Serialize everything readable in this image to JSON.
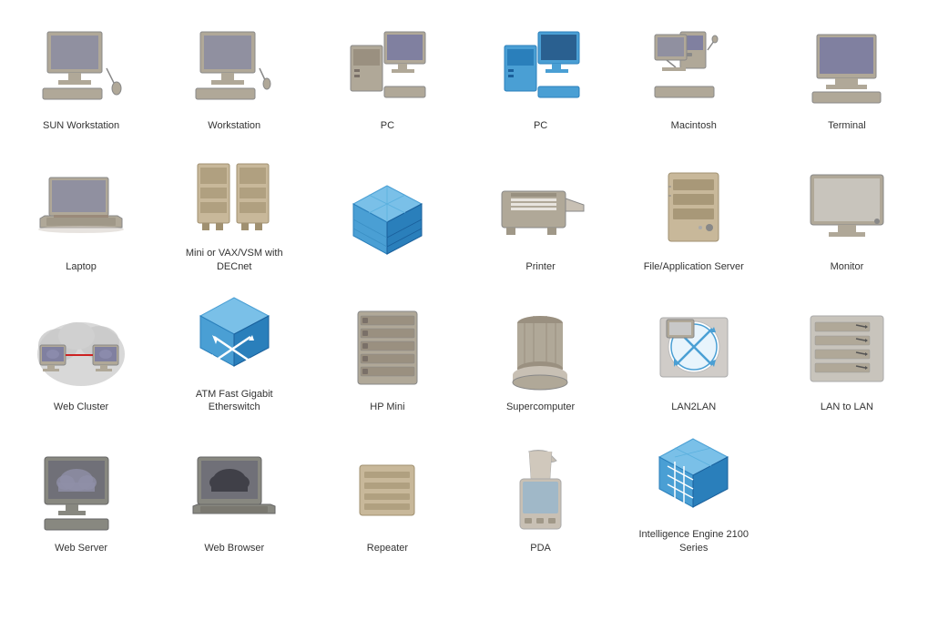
{
  "items": [
    {
      "id": "sun-workstation",
      "label": "SUN Workstation",
      "type": "sun-workstation"
    },
    {
      "id": "workstation",
      "label": "Workstation",
      "type": "workstation"
    },
    {
      "id": "pc-gray",
      "label": "PC",
      "type": "pc-gray"
    },
    {
      "id": "pc-blue",
      "label": "PC",
      "type": "pc-blue"
    },
    {
      "id": "macintosh",
      "label": "Macintosh",
      "type": "macintosh"
    },
    {
      "id": "terminal",
      "label": "Terminal",
      "type": "terminal"
    },
    {
      "id": "laptop",
      "label": "Laptop",
      "type": "laptop"
    },
    {
      "id": "mini-vax",
      "label": "Mini or VAX/VSM with DECnet",
      "type": "mini-vax"
    },
    {
      "id": "atm-cube",
      "label": "",
      "type": "atm-cube"
    },
    {
      "id": "printer",
      "label": "Printer",
      "type": "printer"
    },
    {
      "id": "file-server",
      "label": "File/Application Server",
      "type": "file-server"
    },
    {
      "id": "monitor",
      "label": "Monitor",
      "type": "monitor"
    },
    {
      "id": "web-cluster",
      "label": "Web Cluster",
      "type": "web-cluster"
    },
    {
      "id": "atm-gigabit",
      "label": "ATM Fast Gigabit Etherswitch",
      "type": "atm-gigabit"
    },
    {
      "id": "hp-mini",
      "label": "HP Mini",
      "type": "hp-mini"
    },
    {
      "id": "supercomputer",
      "label": "Supercomputer",
      "type": "supercomputer"
    },
    {
      "id": "lan2lan",
      "label": "LAN2LAN",
      "type": "lan2lan"
    },
    {
      "id": "lan-to-lan",
      "label": "LAN to LAN",
      "type": "lan-to-lan"
    },
    {
      "id": "web-server",
      "label": "Web Server",
      "type": "web-server"
    },
    {
      "id": "web-browser",
      "label": "Web Browser",
      "type": "web-browser"
    },
    {
      "id": "repeater",
      "label": "Repeater",
      "type": "repeater"
    },
    {
      "id": "pda",
      "label": "PDA",
      "type": "pda"
    },
    {
      "id": "intelligence-engine",
      "label": "Intelligence Engine 2100 Series",
      "type": "intelligence-engine"
    }
  ]
}
